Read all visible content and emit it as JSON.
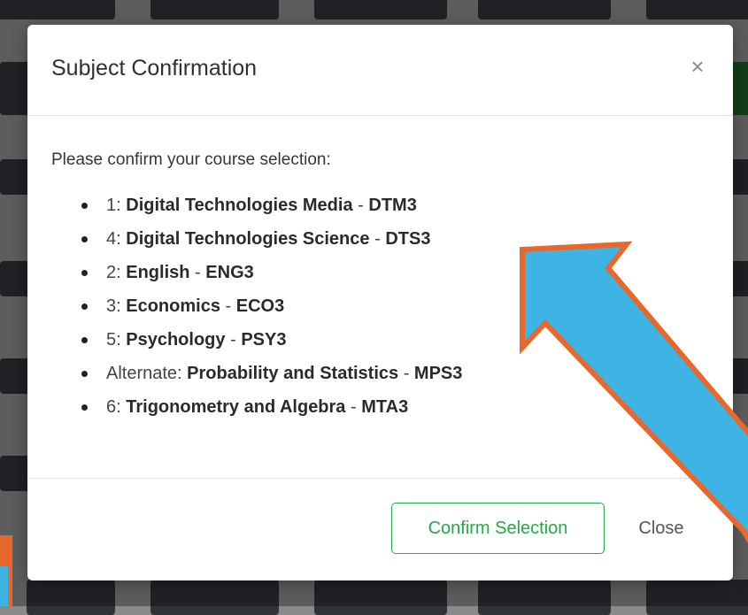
{
  "modal": {
    "title": "Subject Confirmation",
    "close_icon": "close-icon",
    "intro": "Please confirm your course selection:",
    "courses": [
      {
        "label": "1:",
        "name": "Digital Technologies Media",
        "code": "DTM3"
      },
      {
        "label": "4:",
        "name": "Digital Technologies Science",
        "code": "DTS3"
      },
      {
        "label": "2:",
        "name": "English",
        "code": "ENG3"
      },
      {
        "label": "3:",
        "name": "Economics",
        "code": "ECO3"
      },
      {
        "label": "5:",
        "name": "Psychology",
        "code": "PSY3"
      },
      {
        "label": "Alternate:",
        "name": "Probability and Statistics",
        "code": "MPS3"
      },
      {
        "label": "6:",
        "name": "Trigonometry and Algebra",
        "code": "MTA3"
      }
    ],
    "dash": "-",
    "confirm_label": "Confirm Selection",
    "close_label": "Close"
  },
  "colors": {
    "confirm_accent": "#28a745",
    "arrow_fill": "#3db4e3",
    "arrow_outline": "#e8672a"
  },
  "annotation": {
    "arrow_icon": "annotation-arrow-icon"
  }
}
